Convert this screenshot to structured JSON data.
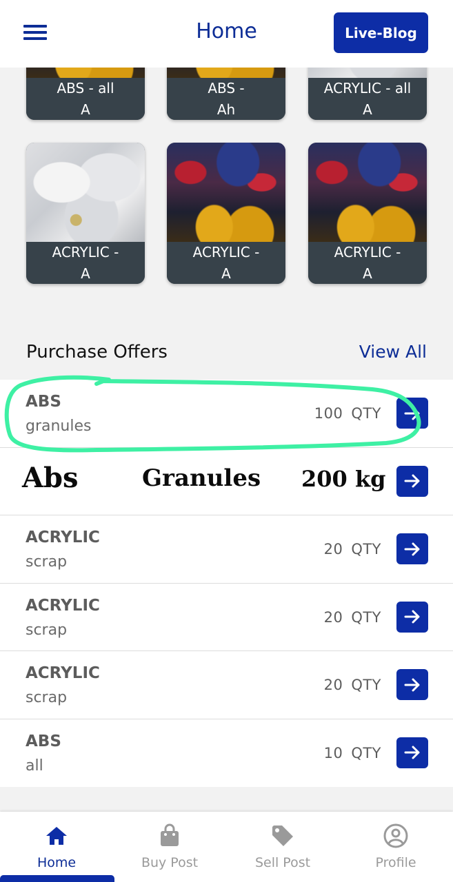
{
  "header": {
    "title": "Home",
    "live_blog_label": "Live-Blog"
  },
  "tiles": [
    {
      "line1": "ABS - all",
      "line2": "A"
    },
    {
      "line1": "ABS -",
      "line2": "Ah"
    },
    {
      "line1": "ACRYLIC - all",
      "line2": "A"
    },
    {
      "line1": "ACRYLIC -",
      "line2": "A"
    },
    {
      "line1": "ACRYLIC -",
      "line2": "A"
    },
    {
      "line1": "ACRYLIC -",
      "line2": "A"
    }
  ],
  "purchase_offers": {
    "title": "Purchase Offers",
    "view_all_label": "View All",
    "unit": "QTY",
    "items": [
      {
        "name": "ABS",
        "type": "granules",
        "qty": "100"
      },
      {
        "name": "Abs",
        "type": "Granules",
        "qty": "200 kg"
      },
      {
        "name": "ACRYLIC",
        "type": "scrap",
        "qty": "20"
      },
      {
        "name": "ACRYLIC",
        "type": "scrap",
        "qty": "20"
      },
      {
        "name": "ACRYLIC",
        "type": "scrap",
        "qty": "20"
      },
      {
        "name": "ABS",
        "type": "all",
        "qty": "10"
      }
    ]
  },
  "bottom_nav": [
    {
      "label": "Home",
      "icon": "home-icon",
      "active": true
    },
    {
      "label": "Buy Post",
      "icon": "shopping-bag-icon",
      "active": false
    },
    {
      "label": "Sell Post",
      "icon": "tag-icon",
      "active": false
    },
    {
      "label": "Profile",
      "icon": "user-circle-icon",
      "active": false
    }
  ],
  "colors": {
    "primary": "#0d2da6",
    "highlight": "#3ef0a4",
    "caption_bg": "#37424a"
  }
}
